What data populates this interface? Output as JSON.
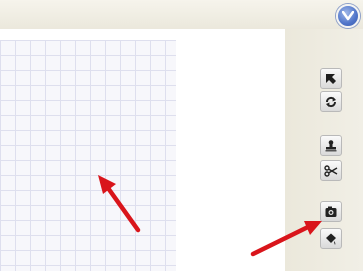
{
  "toolbar": {
    "tools": [
      {
        "name": "select-tool",
        "icon": "arrow-pointer-icon"
      },
      {
        "name": "rotate-tool",
        "icon": "rotate-icon"
      },
      {
        "name": "stamp-tool",
        "icon": "stamp-icon"
      },
      {
        "name": "cut-tool",
        "icon": "scissors-icon"
      },
      {
        "name": "camera-tool",
        "icon": "camera-icon"
      },
      {
        "name": "paint-bucket-tool",
        "icon": "paint-bucket-icon"
      }
    ]
  },
  "header": {
    "collapse_icon": "chevron-down-icon"
  },
  "annotations": {
    "arrow_color": "#d9151b"
  },
  "colors": {
    "grid_line": "#dedfee",
    "grid_background": "#f7f7fb",
    "toolbar_background": "#ece9dd",
    "collapse_button": "#4f74c9"
  }
}
